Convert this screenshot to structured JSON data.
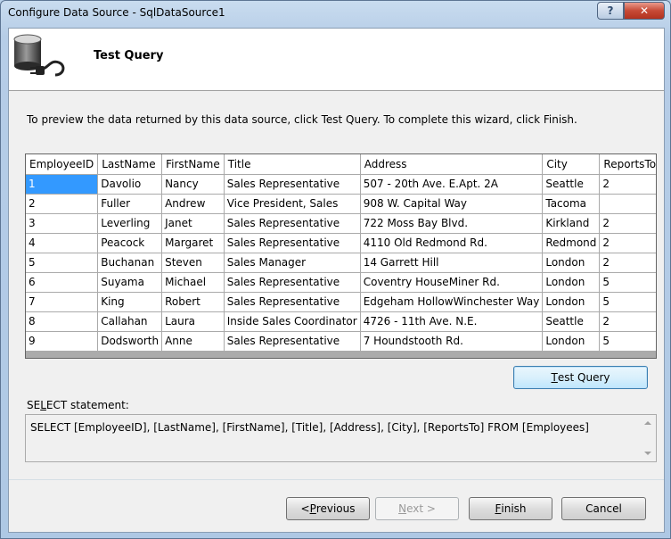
{
  "window": {
    "title": "Configure Data Source - SqlDataSource1",
    "help_label": "?",
    "close_label": "✕"
  },
  "header": {
    "title": "Test Query",
    "icon": "database-plug-icon"
  },
  "instructions": "To preview the data returned by this data source, click Test Query. To complete this wizard, click Finish.",
  "grid": {
    "columns": [
      "EmployeeID",
      "LastName",
      "FirstName",
      "Title",
      "Address",
      "City",
      "ReportsTo"
    ],
    "rows": [
      [
        "1",
        "Davolio",
        "Nancy",
        "Sales Representative",
        "507 - 20th Ave. E.Apt. 2A",
        "Seattle",
        "2"
      ],
      [
        "2",
        "Fuller",
        "Andrew",
        "Vice President, Sales",
        "908 W. Capital Way",
        "Tacoma",
        ""
      ],
      [
        "3",
        "Leverling",
        "Janet",
        "Sales Representative",
        "722 Moss Bay Blvd.",
        "Kirkland",
        "2"
      ],
      [
        "4",
        "Peacock",
        "Margaret",
        "Sales Representative",
        "4110 Old Redmond Rd.",
        "Redmond",
        "2"
      ],
      [
        "5",
        "Buchanan",
        "Steven",
        "Sales Manager",
        "14 Garrett Hill",
        "London",
        "2"
      ],
      [
        "6",
        "Suyama",
        "Michael",
        "Sales Representative",
        "Coventry HouseMiner Rd.",
        "London",
        "5"
      ],
      [
        "7",
        "King",
        "Robert",
        "Sales Representative",
        "Edgeham HollowWinchester Way",
        "London",
        "5"
      ],
      [
        "8",
        "Callahan",
        "Laura",
        "Inside Sales Coordinator",
        "4726 - 11th Ave. N.E.",
        "Seattle",
        "2"
      ],
      [
        "9",
        "Dodsworth",
        "Anne",
        "Sales Representative",
        "7 Houndstooth Rd.",
        "London",
        "5"
      ]
    ]
  },
  "test_query_button": {
    "underline": "T",
    "rest": "est Query"
  },
  "select_statement": {
    "label_a": "SE",
    "label_u": "L",
    "label_b": "ECT statement:",
    "sql": "SELECT [EmployeeID], [LastName], [FirstName], [Title], [Address], [City], [ReportsTo] FROM [Employees]"
  },
  "footer": {
    "previous": {
      "a": "< ",
      "u": "P",
      "b": "revious"
    },
    "next": {
      "u": "N",
      "b": "ext >"
    },
    "finish": {
      "u": "F",
      "b": "inish"
    },
    "cancel": "Cancel"
  },
  "colors": {
    "selection": "#3399ff",
    "window_frame": "#b9d1ea",
    "close_button": "#c74a36"
  }
}
